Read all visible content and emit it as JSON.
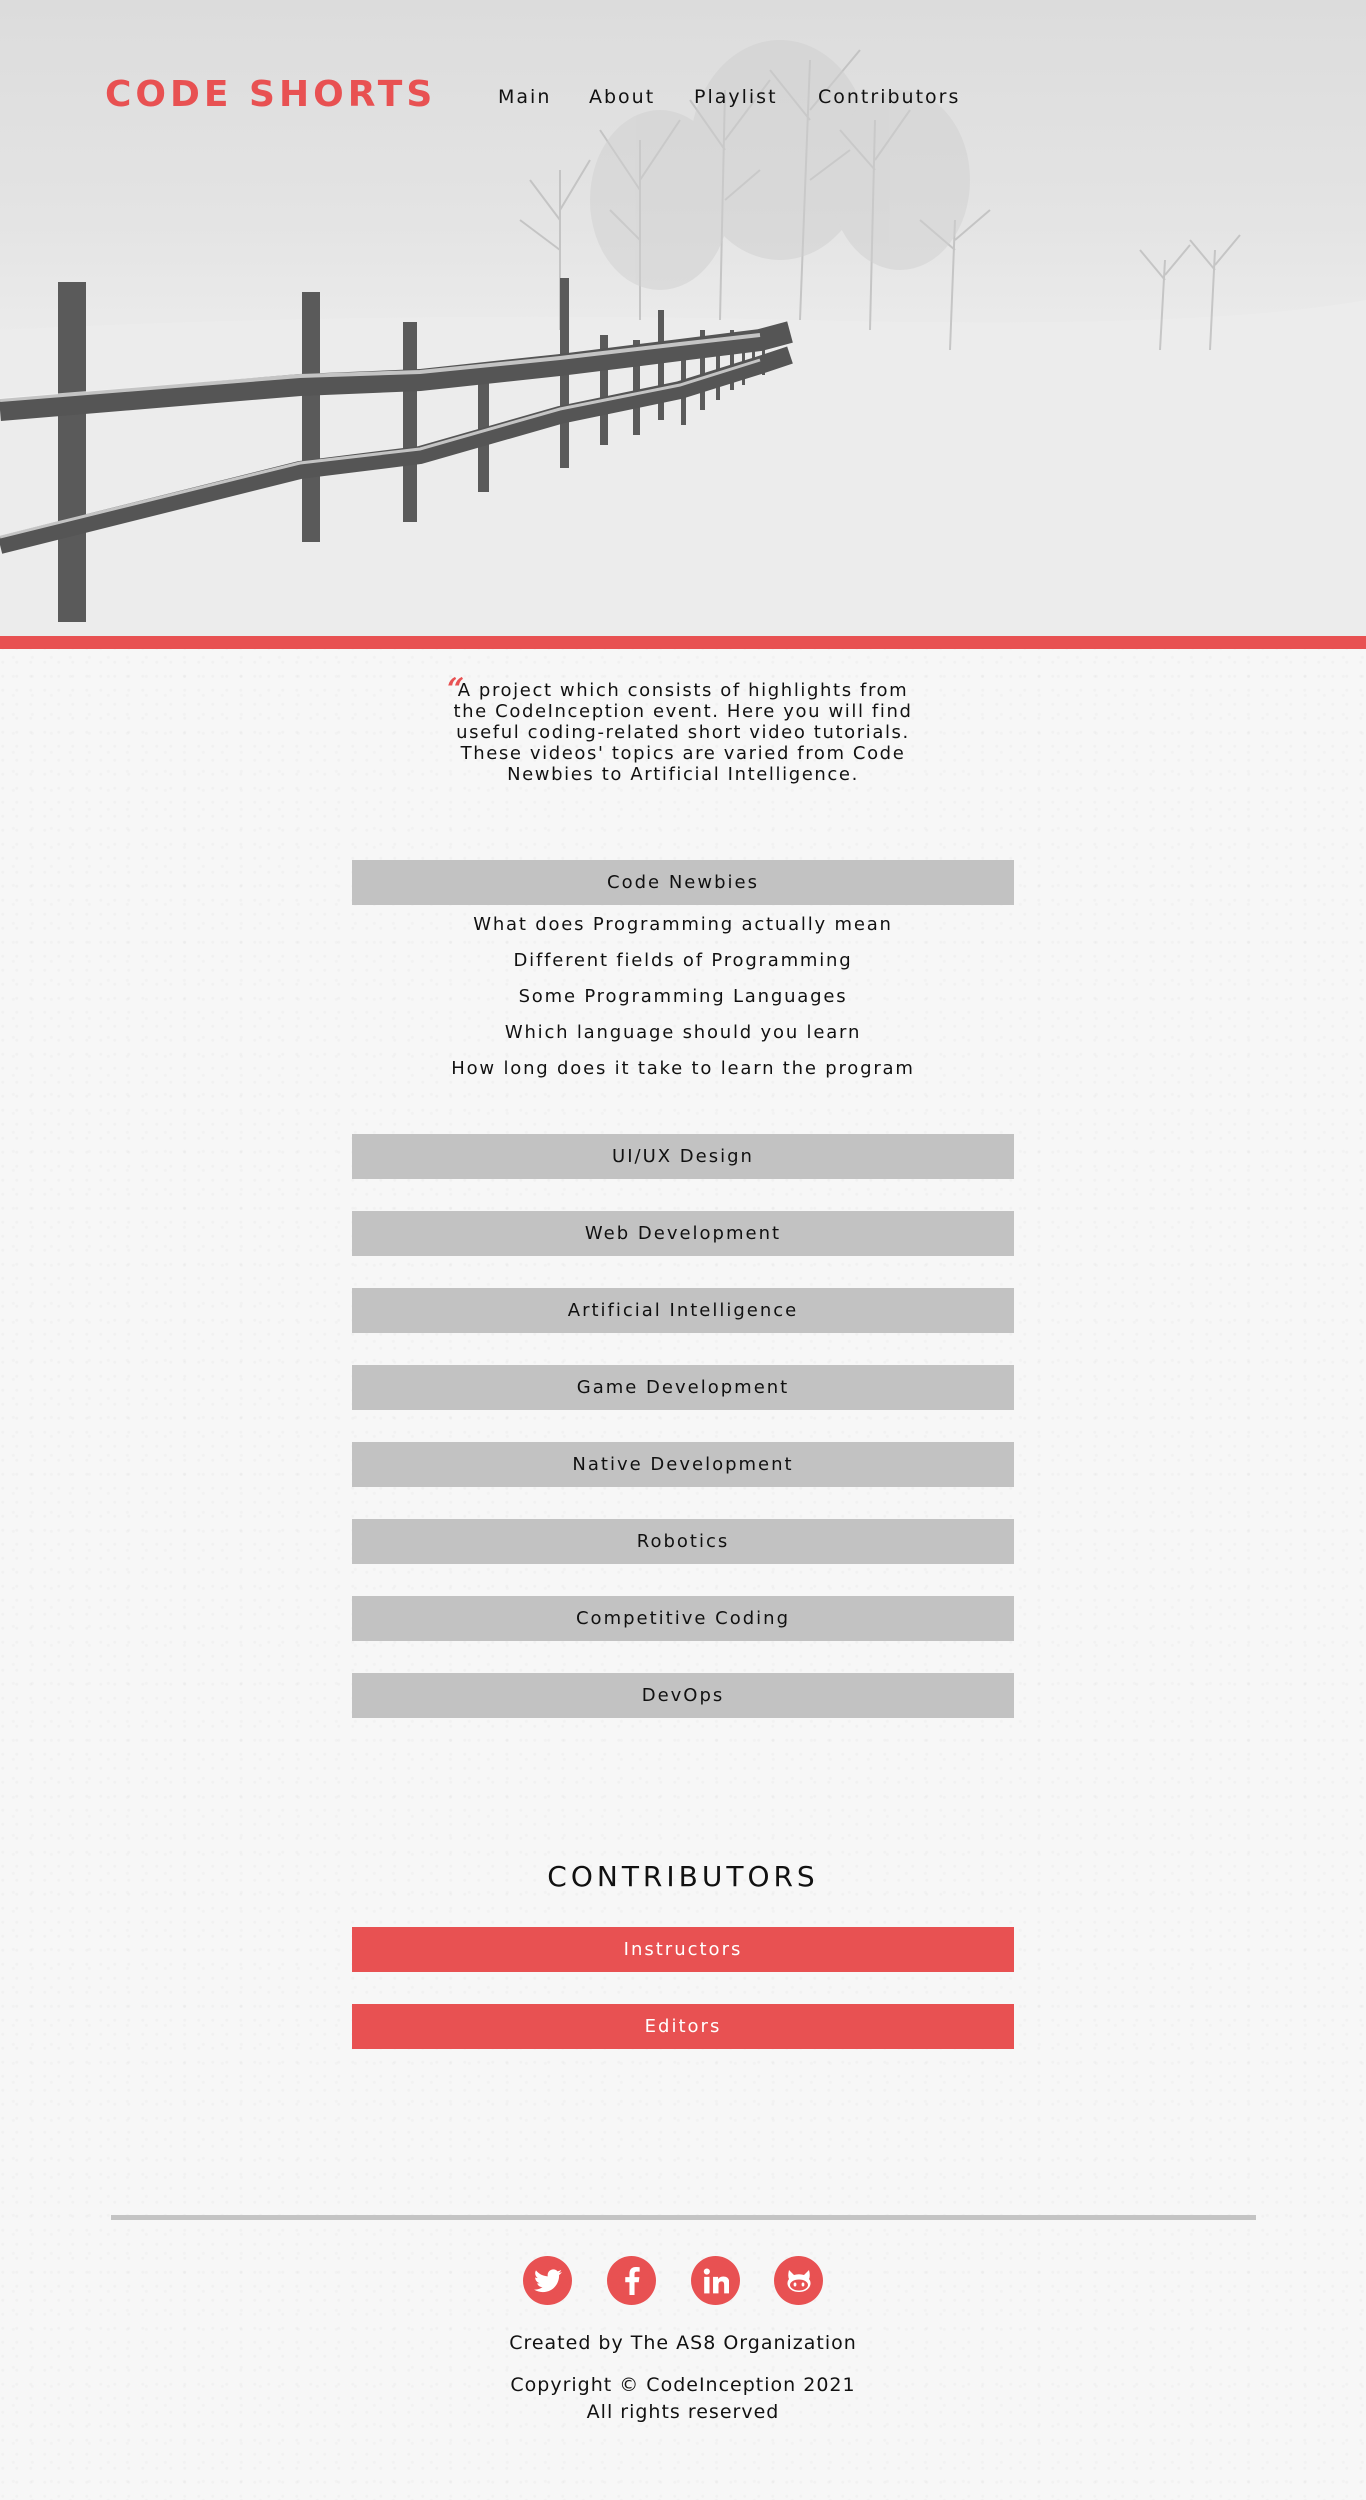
{
  "header": {
    "logo": "CODE SHORTS",
    "nav": [
      "Main",
      "About",
      "Playlist",
      "Contributors"
    ]
  },
  "intro": {
    "quote_mark": "“",
    "lines": [
      "A project which consists of highlights from",
      "the CodeInception event. Here you will find",
      "useful coding-related short video tutorials.",
      "These videos' topics are varied from Code",
      "Newbies to Artificial Intelligence."
    ]
  },
  "playlist": {
    "categories": [
      "Code Newbies",
      "UI/UX Design",
      "Web Development",
      "Artificial Intelligence",
      "Game Development",
      "Native Development",
      "Robotics",
      "Competitive Coding",
      "DevOps"
    ],
    "code_newbies_items": [
      "What does Programming actually mean",
      "Different fields of Programming",
      "Some Programming Languages",
      "Which language should you learn",
      "How long does it take to learn the program"
    ]
  },
  "contributors": {
    "title": "CONTRIBUTORS",
    "buttons": [
      "Instructors",
      "Editors"
    ]
  },
  "footer": {
    "social_icons": [
      "twitter-icon",
      "facebook-icon",
      "linkedin-icon",
      "github-icon"
    ],
    "created_by": "Created by The AS8 Organization",
    "copyright": "Copyright © CodeInception 2021",
    "rights": "All rights reserved"
  },
  "colors": {
    "accent": "#e85152",
    "category_bg": "#c2c2c2",
    "divider": "#c4c4c4"
  }
}
